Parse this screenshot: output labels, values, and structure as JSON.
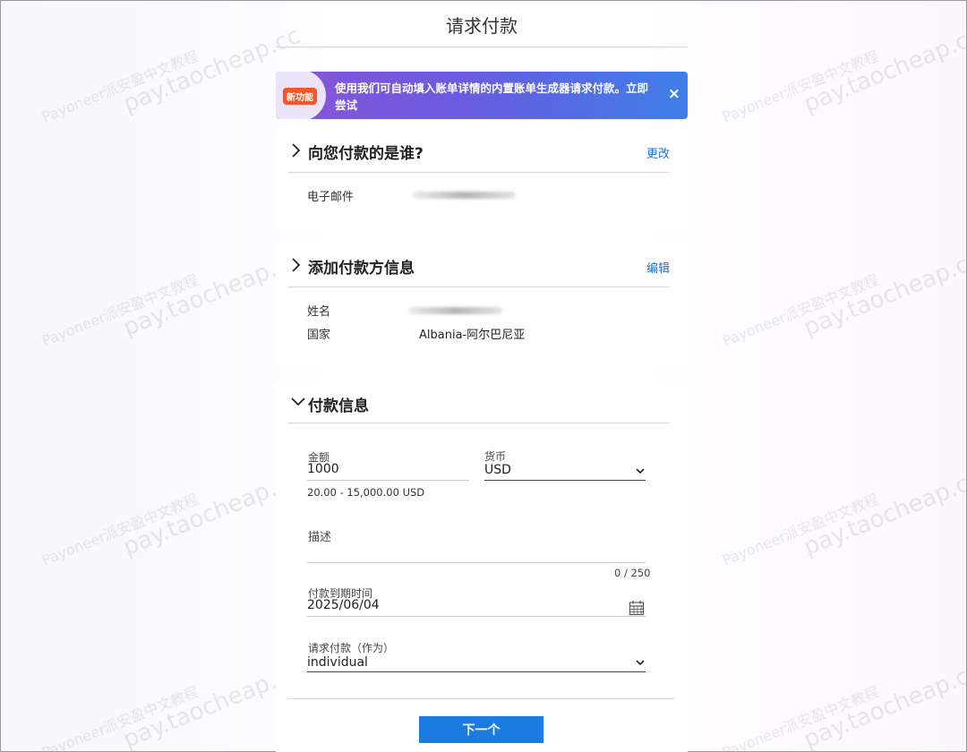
{
  "page": {
    "title": "请求付款"
  },
  "banner": {
    "badge": "新功能",
    "text": "使用我们可自动填入账单详情的内置账单生成器请求付款。立即尝试",
    "close": "×"
  },
  "payer_section": {
    "title": "向您付款的是谁?",
    "action": "更改",
    "email_label": "电子邮件"
  },
  "payer_info_section": {
    "title": "添加付款方信息",
    "action": "编辑",
    "name_label": "姓名",
    "country_label": "国家",
    "country_value": "Albania-阿尔巴尼亚"
  },
  "payment_section": {
    "title": "付款信息",
    "amount_label": "金额",
    "amount_value": "1000",
    "amount_range": "20.00 - 15,000.00 USD",
    "currency_label": "货币",
    "currency_value": "USD",
    "description_label": "描述",
    "description_counter": "0 / 250",
    "due_date_label": "付款到期时间",
    "due_date_value": "2025/06/04",
    "request_as_label": "请求付款（作为）",
    "request_as_value": "individual"
  },
  "next_button": "下一个",
  "watermark": {
    "line1": "Payoneer派安盈中文教程",
    "line2": "pay.taocheap.cc"
  },
  "colors": {
    "accent": "#1c7be0",
    "link": "#1a73d1",
    "badge": "#f4552a",
    "banner_start": "#8a55d9",
    "banner_end": "#3f7ee8"
  }
}
